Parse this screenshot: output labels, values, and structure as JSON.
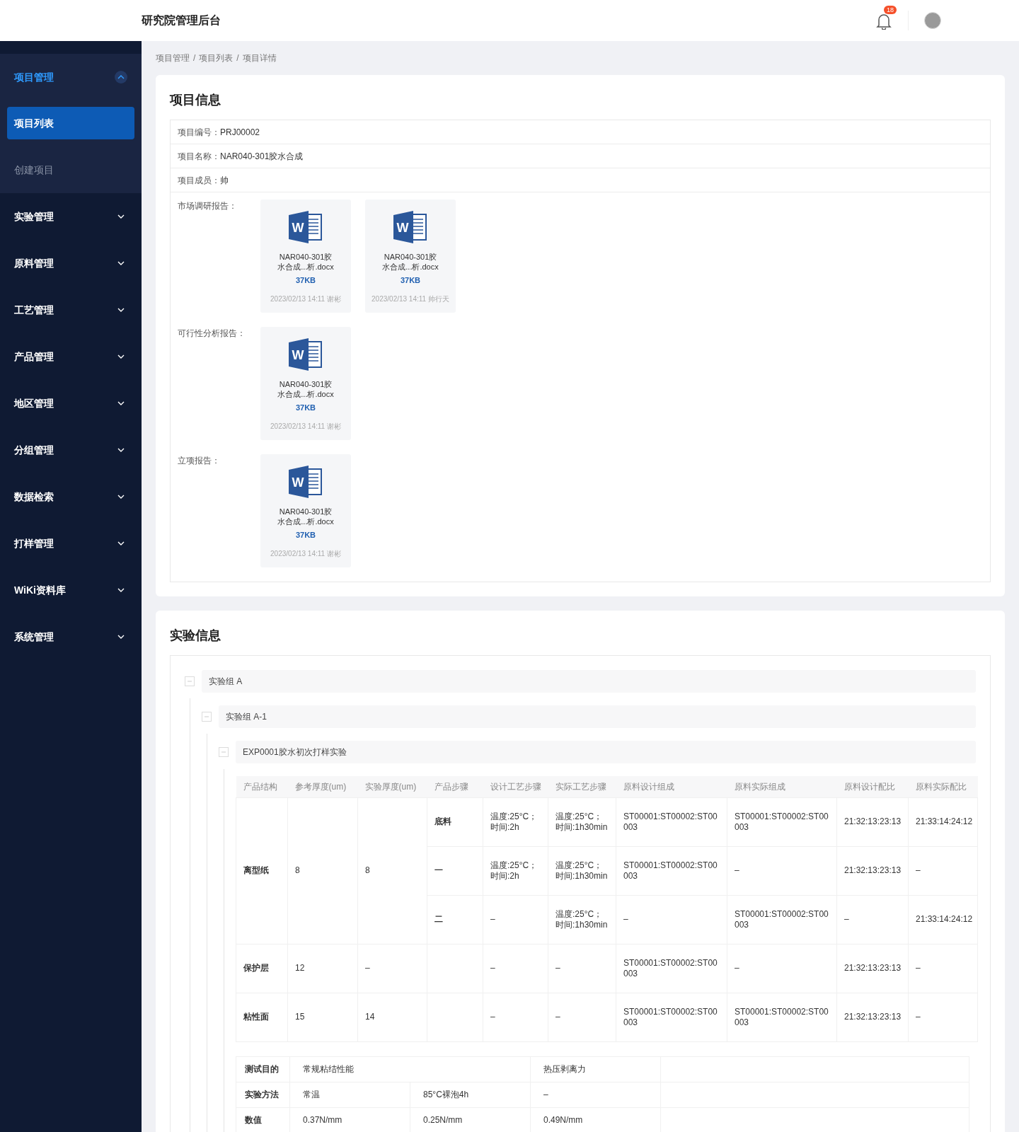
{
  "header": {
    "title": "研究院管理后台",
    "notification_count": "18"
  },
  "sidebar": {
    "items": [
      {
        "label": "项目管理",
        "expanded": true,
        "selected": true,
        "children": [
          {
            "label": "项目列表",
            "selected": true
          },
          {
            "label": "创建项目",
            "selected": false
          }
        ]
      },
      {
        "label": "实验管理",
        "expanded": false,
        "selected": false
      },
      {
        "label": "原料管理",
        "expanded": false,
        "selected": false
      },
      {
        "label": "工艺管理",
        "expanded": false,
        "selected": false
      },
      {
        "label": "产品管理",
        "expanded": false,
        "selected": false
      },
      {
        "label": "地区管理",
        "expanded": false,
        "selected": false
      },
      {
        "label": "分组管理",
        "expanded": false,
        "selected": false
      },
      {
        "label": "数据检索",
        "expanded": false,
        "selected": false
      },
      {
        "label": "打样管理",
        "expanded": false,
        "selected": false
      },
      {
        "label": "WiKi资料库",
        "expanded": false,
        "selected": false
      },
      {
        "label": "系统管理",
        "expanded": false,
        "selected": false
      }
    ]
  },
  "breadcrumb": {
    "separator": "/",
    "items": [
      "项目管理",
      "项目列表",
      "项目详情"
    ]
  },
  "project_info": {
    "title": "项目信息",
    "fields": [
      {
        "label": "项目编号：",
        "value": "PRJ00002"
      },
      {
        "label": "项目名称：",
        "value": "NAR040-301胶水合成"
      },
      {
        "label": "项目成员：",
        "value": "帅"
      }
    ],
    "attachments": [
      {
        "label": "市场调研报告：",
        "files": [
          {
            "icon_letter": "W",
            "name": "NAR040-301胶水合成...析.docx",
            "size": "37KB",
            "uploaded": "2023/02/13 14:11 谢彬"
          },
          {
            "icon_letter": "W",
            "name": "NAR040-301胶水合成...析.docx",
            "size": "37KB",
            "uploaded": "2023/02/13 14:11 帅行天"
          }
        ]
      },
      {
        "label": "可行性分析报告：",
        "files": [
          {
            "icon_letter": "W",
            "name": "NAR040-301胶水合成...析.docx",
            "size": "37KB",
            "uploaded": "2023/02/13 14:11 谢彬"
          }
        ]
      },
      {
        "label": "立项报告：",
        "files": [
          {
            "icon_letter": "W",
            "name": "NAR040-301胶水合成...析.docx",
            "size": "37KB",
            "uploaded": "2023/02/13 14:11 谢彬"
          }
        ]
      }
    ]
  },
  "experiment_info": {
    "title": "实验信息",
    "tree": [
      {
        "label": "实验组 A",
        "expanded": true,
        "children": [
          {
            "label": "实验组 A-1",
            "expanded": true,
            "children": [
              {
                "label": "EXP0001胶水初次打样实验",
                "expanded": true,
                "table": {
                  "columns": [
                    "产品结构",
                    "参考厚度(um)",
                    "实验厚度(um)",
                    "产品步骤",
                    "设计工艺步骤",
                    "实际工艺步骤",
                    "原料设计组成",
                    "原料实际组成",
                    "原料设计配比",
                    "原料实际配比"
                  ],
                  "rows": [
                    {
                      "structure": "离型纸",
                      "ref_thickness": "8",
                      "exp_thickness": "8",
                      "steps": [
                        {
                          "step": "底料",
                          "design_process": "温度:25°C；时间:2h",
                          "actual_process": "温度:25°C；时间:1h30min",
                          "material_design": "ST00001:ST00002:ST00003",
                          "material_actual": "ST00001:ST00002:ST00003",
                          "design_ratio": "21:32:13:23:13",
                          "actual_ratio": "21:33:14:24:12"
                        },
                        {
                          "step": "一",
                          "design_process": "温度:25°C；时间:2h",
                          "actual_process": "温度:25°C；时间:1h30min",
                          "material_design": "ST00001:ST00002:ST00003",
                          "material_actual": "–",
                          "design_ratio": "21:32:13:23:13",
                          "actual_ratio": "–"
                        },
                        {
                          "step": "二",
                          "design_process": "–",
                          "actual_process": "温度:25°C；时间:1h30min",
                          "material_design": "–",
                          "material_actual": "ST00001:ST00002:ST00003",
                          "design_ratio": "–",
                          "actual_ratio": "21:33:14:24:12"
                        }
                      ]
                    },
                    {
                      "structure": "保护层",
                      "ref_thickness": "12",
                      "exp_thickness": "–",
                      "steps": [
                        {
                          "design_process": "–",
                          "actual_process": "–",
                          "material_design": "ST00001:ST00002:ST00003",
                          "material_actual": "–",
                          "design_ratio": "21:32:13:23:13",
                          "actual_ratio": "–"
                        }
                      ]
                    },
                    {
                      "structure": "粘性面",
                      "ref_thickness": "15",
                      "exp_thickness": "14",
                      "steps": [
                        {
                          "design_process": "–",
                          "actual_process": "–",
                          "material_design": "ST00001:ST00002:ST00003",
                          "material_actual": "ST00001:ST00002:ST00003",
                          "design_ratio": "21:32:13:23:13",
                          "actual_ratio": "–"
                        }
                      ]
                    }
                  ]
                },
                "test_table": {
                  "rows": [
                    {
                      "label": "测试目的",
                      "cells": [
                        {
                          "text": "常规粘结性能",
                          "colspan": 2
                        },
                        {
                          "text": "热压剥离力"
                        }
                      ]
                    },
                    {
                      "label": "实验方法",
                      "cells": [
                        {
                          "text": "常温"
                        },
                        {
                          "text": "85°C裸泡4h"
                        },
                        {
                          "text": "–"
                        }
                      ]
                    },
                    {
                      "label": "数值",
                      "cells": [
                        {
                          "text": "0.37N/mm"
                        },
                        {
                          "text": "0.25N/mm"
                        },
                        {
                          "text": "0.49N/mm"
                        }
                      ]
                    }
                  ]
                }
              }
            ]
          }
        ]
      }
    ]
  }
}
